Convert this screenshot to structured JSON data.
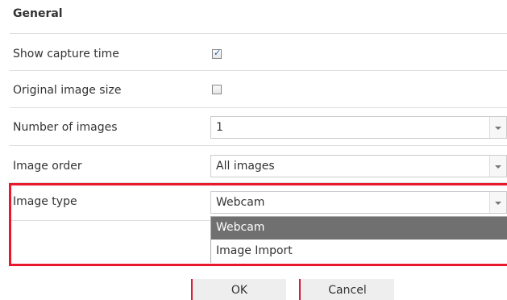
{
  "section": {
    "title": "General"
  },
  "rows": {
    "show_capture_time": {
      "label": "Show capture time",
      "checked": true
    },
    "original_image_size": {
      "label": "Original image size",
      "checked": false
    },
    "number_of_images": {
      "label": "Number of images",
      "value": "1"
    },
    "image_order": {
      "label": "Image order",
      "value": "All images"
    },
    "image_type": {
      "label": "Image type",
      "value": "Webcam"
    }
  },
  "dropdown": {
    "options": [
      "Webcam",
      "Image Import"
    ],
    "selected": "Webcam"
  },
  "buttons": {
    "ok": "OK",
    "cancel": "Cancel"
  },
  "icons": {
    "checkmark": "✓"
  },
  "colors": {
    "highlight": "#e8192c",
    "selected_option_bg": "#707070",
    "accent_check": "#2a56b8"
  }
}
